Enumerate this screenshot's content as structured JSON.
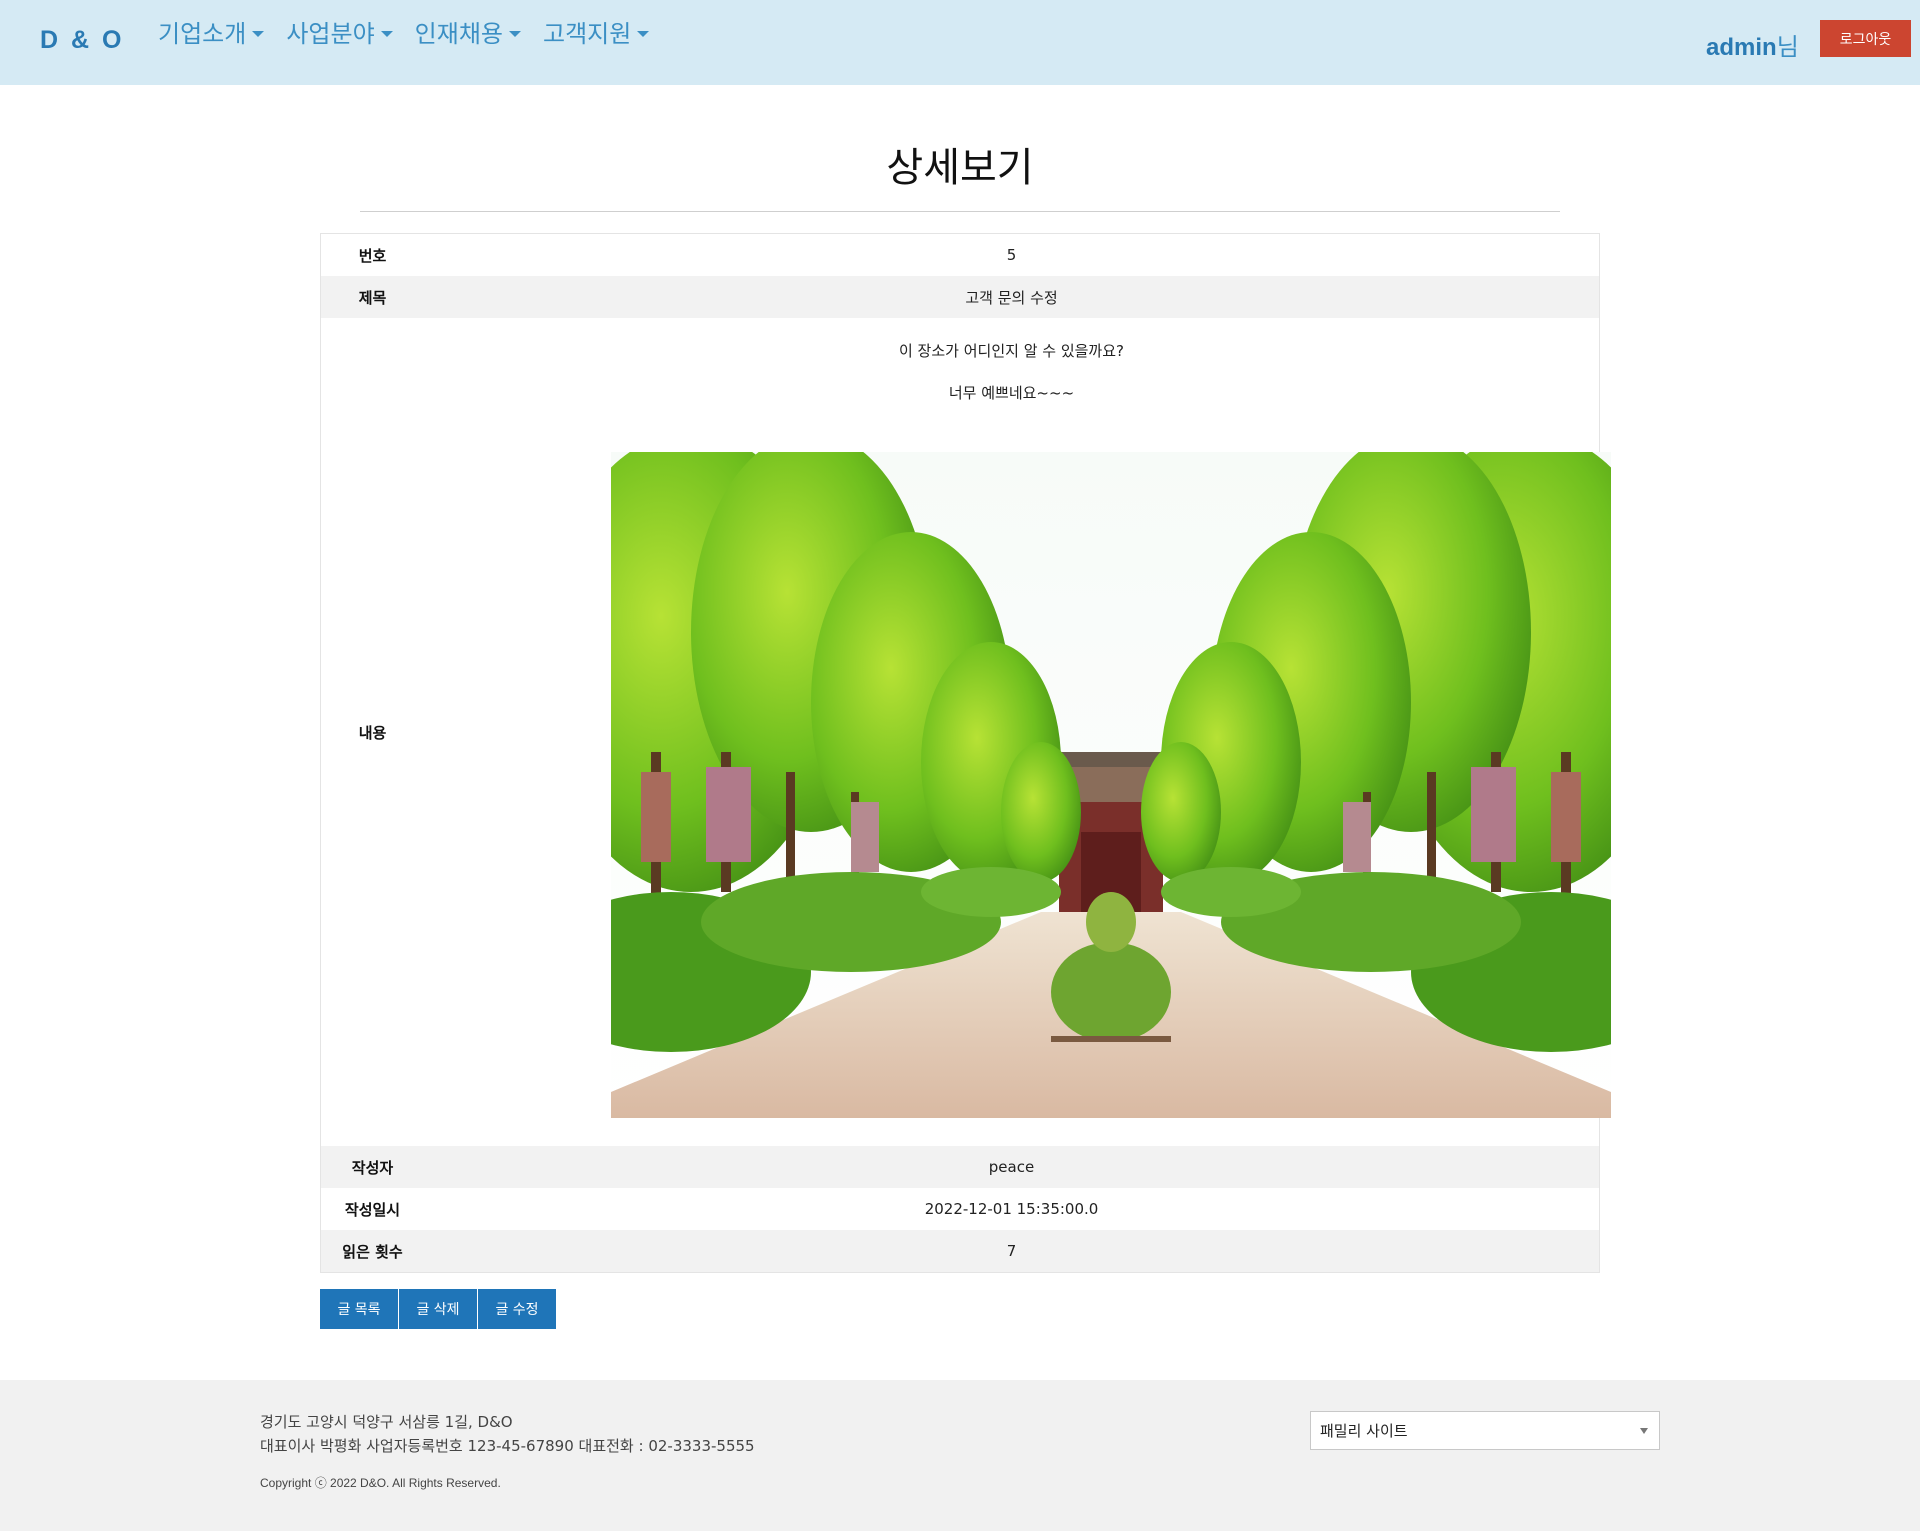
{
  "header": {
    "brand": "D & O",
    "nav": [
      {
        "label": "기업소개"
      },
      {
        "label": "사업분야"
      },
      {
        "label": "인재채용"
      },
      {
        "label": "고객지원"
      }
    ],
    "user_name": "admin",
    "user_suffix": "님",
    "logout_label": "로그아웃"
  },
  "page": {
    "title": "상세보기"
  },
  "detail": {
    "number_label": "번호",
    "number_value": "5",
    "subject_label": "제목",
    "subject_value": "고객 문의 수정",
    "content_label": "내용",
    "content_line1": "이 장소가 어디인지 알 수 있을까요?",
    "content_line2": "너무 예쁘네요~~~",
    "writer_label": "작성자",
    "writer_value": "peace",
    "date_label": "작성일시",
    "date_value": "2022-12-01 15:35:00.0",
    "views_label": "읽은 횟수",
    "views_value": "7"
  },
  "actions": {
    "list_label": "글 목록",
    "delete_label": "글 삭제",
    "edit_label": "글 수정"
  },
  "footer": {
    "address": "경기도 고양시 덕양구 서삼릉 1길, D&O",
    "info": "대표이사 박평화 사업자등록번호 123-45-67890 대표전화 : 02-3333-5555",
    "copyright": "Copyright ⓒ 2022 D&O. All Rights Reserved.",
    "family_site": "패밀리 사이트"
  },
  "colors": {
    "header_bg": "#d5eaf4",
    "brand": "#2a7ab3",
    "logout_bg": "#cc4530",
    "button_bg": "#1f75b8",
    "footer_bg": "#f1f1f1"
  }
}
